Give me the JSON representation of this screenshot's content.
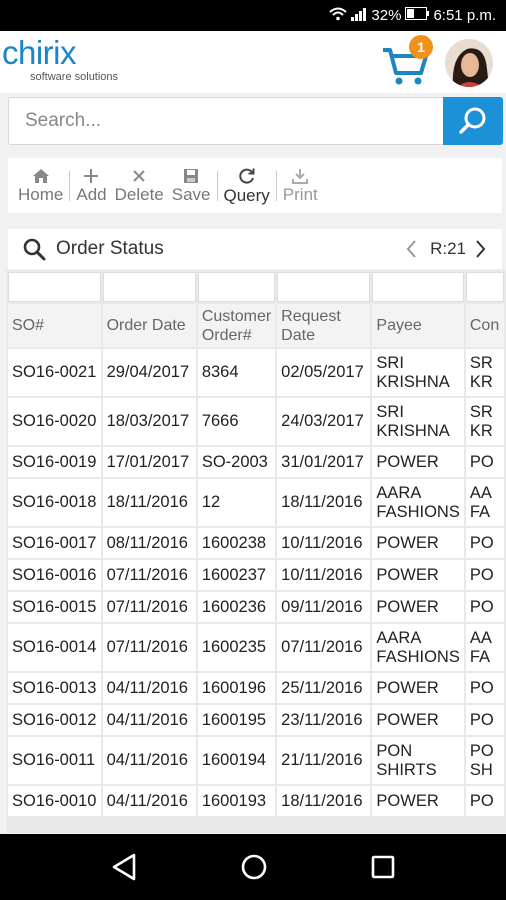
{
  "status_bar": {
    "signal_pct": "32%",
    "time": "6:51 p.m."
  },
  "header": {
    "brand": "chirix",
    "tagline": "software solutions",
    "cart_count": "1"
  },
  "search": {
    "placeholder": "Search..."
  },
  "toolbar": {
    "home": "Home",
    "add": "Add",
    "delete": "Delete",
    "save": "Save",
    "query": "Query",
    "print": "Print"
  },
  "section": {
    "title": "Order Status",
    "record": "R:21"
  },
  "table": {
    "headers": {
      "so": "SO#",
      "order_date": "Order Date",
      "customer_order_1": "Customer",
      "customer_order_2": "Order#",
      "request_1": "Request",
      "request_2": "Date",
      "payee": "Payee",
      "con": "Con"
    },
    "rows": [
      {
        "so": "SO16-0021",
        "order_date": "29/04/2017",
        "customer_order": "8364",
        "request_date": "02/05/2017",
        "payee_1": "SRI",
        "payee_2": "KRISHNA",
        "con_1": "SR",
        "con_2": "KR"
      },
      {
        "so": "SO16-0020",
        "order_date": "18/03/2017",
        "customer_order": "7666",
        "request_date": "24/03/2017",
        "payee_1": "SRI",
        "payee_2": "KRISHNA",
        "con_1": "SR",
        "con_2": "KR"
      },
      {
        "so": "SO16-0019",
        "order_date": "17/01/2017",
        "customer_order": "SO-2003",
        "request_date": "31/01/2017",
        "payee_1": "POWER",
        "payee_2": "",
        "con_1": "PO",
        "con_2": ""
      },
      {
        "so": "SO16-0018",
        "order_date": "18/11/2016",
        "customer_order": "12",
        "request_date": "18/11/2016",
        "payee_1": "AARA",
        "payee_2": "FASHIONS",
        "con_1": "AA",
        "con_2": "FA"
      },
      {
        "so": "SO16-0017",
        "order_date": "08/11/2016",
        "customer_order": "1600238",
        "request_date": "10/11/2016",
        "payee_1": "POWER",
        "payee_2": "",
        "con_1": "PO",
        "con_2": ""
      },
      {
        "so": "SO16-0016",
        "order_date": "07/11/2016",
        "customer_order": "1600237",
        "request_date": "10/11/2016",
        "payee_1": "POWER",
        "payee_2": "",
        "con_1": "PO",
        "con_2": ""
      },
      {
        "so": "SO16-0015",
        "order_date": "07/11/2016",
        "customer_order": "1600236",
        "request_date": "09/11/2016",
        "payee_1": "POWER",
        "payee_2": "",
        "con_1": "PO",
        "con_2": ""
      },
      {
        "so": "SO16-0014",
        "order_date": "07/11/2016",
        "customer_order": "1600235",
        "request_date": "07/11/2016",
        "payee_1": "AARA",
        "payee_2": "FASHIONS",
        "con_1": "AA",
        "con_2": "FA"
      },
      {
        "so": "SO16-0013",
        "order_date": "04/11/2016",
        "customer_order": "1600196",
        "request_date": "25/11/2016",
        "payee_1": "POWER",
        "payee_2": "",
        "con_1": "PO",
        "con_2": ""
      },
      {
        "so": "SO16-0012",
        "order_date": "04/11/2016",
        "customer_order": "1600195",
        "request_date": "23/11/2016",
        "payee_1": "POWER",
        "payee_2": "",
        "con_1": "PO",
        "con_2": ""
      },
      {
        "so": "SO16-0011",
        "order_date": "04/11/2016",
        "customer_order": "1600194",
        "request_date": "21/11/2016",
        "payee_1": "PON",
        "payee_2": "SHIRTS",
        "con_1": "PO",
        "con_2": "SH"
      },
      {
        "so": "SO16-0010",
        "order_date": "04/11/2016",
        "customer_order": "1600193",
        "request_date": "18/11/2016",
        "payee_1": "POWER",
        "payee_2": "",
        "con_1": "PO",
        "con_2": ""
      }
    ]
  },
  "colors": {
    "brand": "#1b86c7",
    "search_button": "#1d91d7",
    "badge": "#f0911c"
  },
  "icons": [
    "wifi-icon",
    "signal-icon",
    "battery-icon",
    "cart-icon",
    "search-icon",
    "home-icon",
    "add-icon",
    "delete-icon",
    "save-icon",
    "refresh-icon",
    "print-icon",
    "chevron-left-icon",
    "chevron-right-icon",
    "back-icon",
    "home-circle-icon",
    "recents-icon"
  ]
}
